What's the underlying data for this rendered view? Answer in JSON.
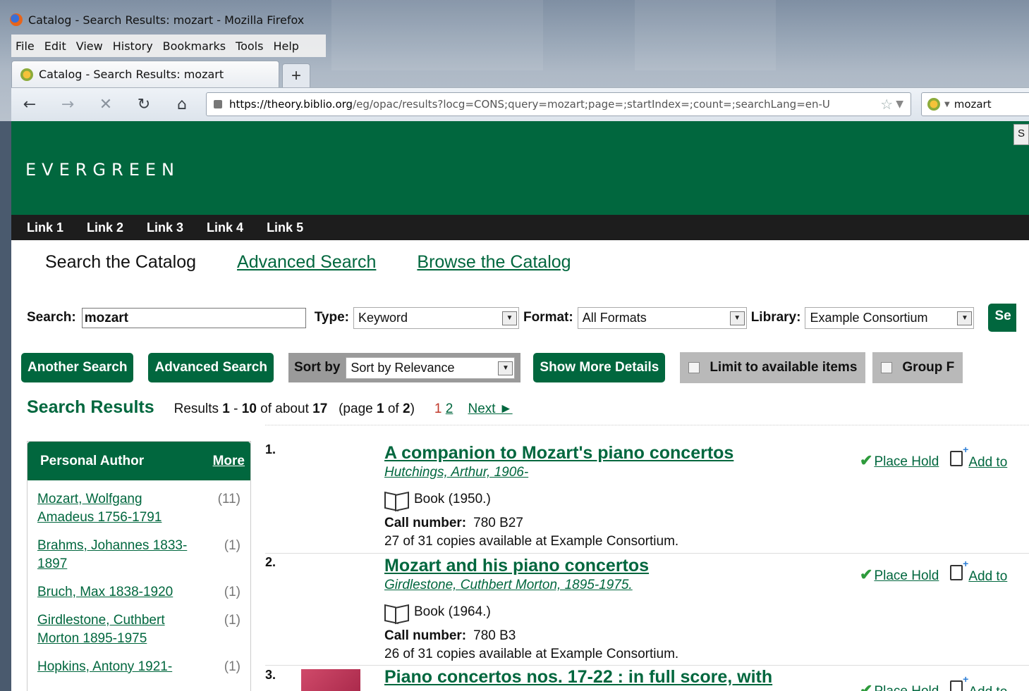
{
  "window": {
    "title": "Catalog - Search Results: mozart - Mozilla Firefox",
    "menu": [
      "File",
      "Edit",
      "View",
      "History",
      "Bookmarks",
      "Tools",
      "Help"
    ],
    "tab_title": "Catalog - Search Results: mozart",
    "new_tab": "+",
    "url_host": "https://theory.biblio.org",
    "url_path": "/eg/opac/results?locg=CONS;query=mozart;page=;startIndex=;count=;searchLang=en-U",
    "search_value": "mozart",
    "nav_icons": [
      "back-icon",
      "forward-icon",
      "stop-icon",
      "reload-icon",
      "home-icon"
    ]
  },
  "header": {
    "logo": "EVERGREEN",
    "right_button": "S"
  },
  "topnav": [
    "Link 1",
    "Link 2",
    "Link 3",
    "Link 4",
    "Link 5"
  ],
  "searchtabs": {
    "current": "Search the Catalog",
    "advanced": "Advanced Search",
    "browse": "Browse the Catalog"
  },
  "search": {
    "label": "Search:",
    "value": "mozart",
    "type_label": "Type:",
    "type_value": "Keyword",
    "format_label": "Format:",
    "format_value": "All Formats",
    "library_label": "Library:",
    "library_value": "Example Consortium",
    "go_button": "Se"
  },
  "buttons": {
    "another_search": "Another Search",
    "advanced_search": "Advanced Search",
    "sort_label": "Sort by",
    "sort_value": "Sort by Relevance",
    "show_more": "Show More Details",
    "limit_available": "Limit to available items",
    "group": "Group F"
  },
  "results_bar": {
    "heading": "Search Results",
    "text_results": "Results",
    "range_start": "1",
    "dash": "-",
    "range_end": "10",
    "text_of_about": "of about",
    "total": "17",
    "page_open": "(page",
    "page_cur": "1",
    "page_of": "of",
    "page_total": "2",
    "page_close": ")",
    "page_link_1": "1",
    "page_link_2": "2",
    "next": "Next ►"
  },
  "facet": {
    "title": "Personal Author",
    "more": "More",
    "items": [
      {
        "name": "Mozart, Wolfgang Amadeus 1756-1791",
        "count": "(11)"
      },
      {
        "name": "Brahms, Johannes 1833-1897",
        "count": "(1)"
      },
      {
        "name": "Bruch, Max 1838-1920",
        "count": "(1)"
      },
      {
        "name": "Girdlestone, Cuthbert Morton 1895-1975",
        "count": "(1)"
      },
      {
        "name": "Hopkins, Antony 1921-",
        "count": "(1)"
      }
    ]
  },
  "results": [
    {
      "num": "1.",
      "title": "A companion to Mozart's piano concertos",
      "author": "Hutchings, Arthur, 1906-",
      "format": "Book (1950.)",
      "call_label": "Call number:",
      "call": "780 B27",
      "copies": "27 of 31 copies available at Example Consortium.",
      "hold": "Place Hold",
      "add": "Add to"
    },
    {
      "num": "2.",
      "title": "Mozart and his piano concertos",
      "author": "Girdlestone, Cuthbert Morton, 1895-1975.",
      "format": "Book (1964.)",
      "call_label": "Call number:",
      "call": "780 B3",
      "copies": "26 of 31 copies available at Example Consortium.",
      "hold": "Place Hold",
      "add": "Add to"
    },
    {
      "num": "3.",
      "title": "Piano concertos nos. 17-22 : in full score, with",
      "hold": "Place Hold",
      "add": "Add to"
    }
  ]
}
